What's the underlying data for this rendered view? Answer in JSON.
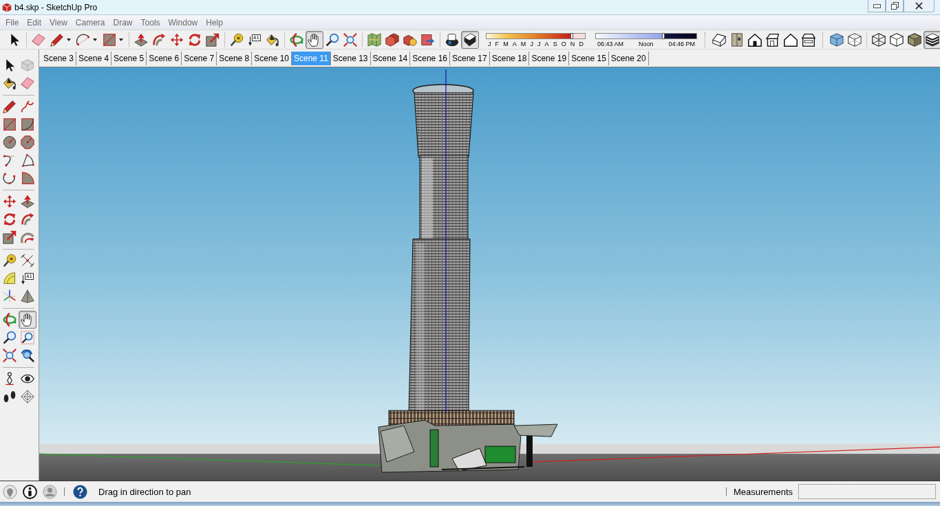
{
  "window": {
    "title": "b4.skp - SketchUp Pro"
  },
  "menu": [
    "File",
    "Edit",
    "View",
    "Camera",
    "Draw",
    "Tools",
    "Window",
    "Help"
  ],
  "toolbar": {
    "buttons": [
      {
        "selected": false
      },
      {
        "selected": false
      },
      {
        "selected": false
      },
      {
        "selected": false
      },
      {
        "selected": false
      },
      {
        "selected": false
      },
      {
        "selected": false
      },
      {
        "selected": false
      },
      {
        "selected": false
      },
      {
        "selected": false
      },
      {
        "selected": false
      },
      {
        "selected": false,
        "label": "A1"
      },
      {
        "selected": false
      },
      {
        "selected": false
      },
      {
        "selected": true
      },
      {
        "selected": false
      },
      {
        "selected": false
      },
      {
        "selected": false
      },
      {
        "selected": false
      },
      {
        "selected": false
      },
      {
        "selected": false
      },
      {
        "selected": false
      },
      {
        "selected": true
      },
      {
        "selected": false
      },
      {
        "selected": false
      },
      {
        "selected": false
      },
      {
        "selected": false
      },
      {
        "selected": false
      },
      {
        "selected": false
      },
      {
        "selected": false
      },
      {
        "selected": false
      },
      {
        "selected": false
      },
      {
        "selected": false
      },
      {
        "selected": false
      },
      {
        "selected": true
      }
    ]
  },
  "shadow_settings": {
    "month_slider": {
      "level": 0.87,
      "labels": [
        "J",
        "F",
        "M",
        "A",
        "M",
        "J",
        "J",
        "A",
        "S",
        "O",
        "N",
        "D"
      ]
    },
    "time_slider": {
      "level": 0.67,
      "labels": [
        "06:43 AM",
        "Noon",
        "04:46 PM"
      ]
    }
  },
  "scene_tabs": [
    {
      "label": "Scene 3",
      "selected": false
    },
    {
      "label": "Scene 4",
      "selected": false
    },
    {
      "label": "Scene 5",
      "selected": false
    },
    {
      "label": "Scene 6",
      "selected": false
    },
    {
      "label": "Scene 7",
      "selected": false
    },
    {
      "label": "Scene 8",
      "selected": false
    },
    {
      "label": "Scene 10",
      "selected": false
    },
    {
      "label": "Scene 11",
      "selected": true
    },
    {
      "label": "Scene 13",
      "selected": false
    },
    {
      "label": "Scene 14",
      "selected": false
    },
    {
      "label": "Scene 16",
      "selected": false
    },
    {
      "label": "Scene 17",
      "selected": false
    },
    {
      "label": "Scene 18",
      "selected": false
    },
    {
      "label": "Scene 19",
      "selected": false
    },
    {
      "label": "Scene 15",
      "selected": false
    },
    {
      "label": "Scene 20",
      "selected": false
    }
  ],
  "left_toolbar": {
    "buttons": [
      {
        "selected": false
      },
      {
        "selected": false
      },
      {
        "selected": false
      },
      {
        "selected": false
      },
      {
        "selected": false
      },
      {
        "selected": false
      },
      {
        "selected": false
      },
      {
        "selected": false
      },
      {
        "selected": false
      },
      {
        "selected": false
      },
      {
        "selected": false
      },
      {
        "selected": false
      },
      {
        "selected": false
      },
      {
        "selected": false
      },
      {
        "selected": false
      },
      {
        "selected": false
      },
      {
        "selected": false
      },
      {
        "selected": false
      },
      {
        "selected": false
      },
      {
        "selected": false
      },
      {
        "selected": false
      },
      {
        "selected": false
      },
      {
        "selected": false
      },
      {
        "selected": false,
        "label": "A1"
      },
      {
        "selected": false
      },
      {
        "selected": false
      },
      {
        "selected": false
      },
      {
        "selected": true
      },
      {
        "selected": false
      },
      {
        "selected": false
      },
      {
        "selected": false
      },
      {
        "selected": false
      },
      {
        "selected": false
      },
      {
        "selected": false
      },
      {
        "selected": false
      },
      {
        "selected": false
      }
    ]
  },
  "status_bar": {
    "hint": "Drag in direction to pan",
    "measurements_label": "Measurements"
  }
}
